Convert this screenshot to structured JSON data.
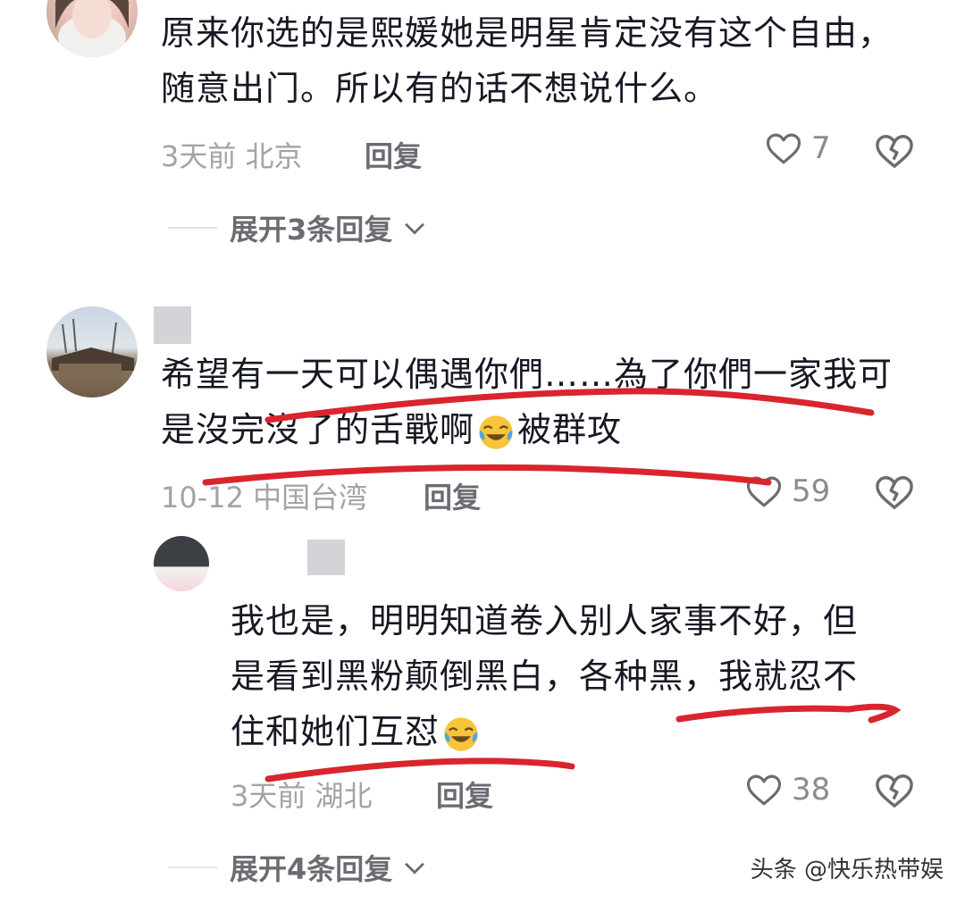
{
  "comments": [
    {
      "text": "原来你选的是熙媛她是明星肯定没有这个自由，随意出门。所以有的话不想说什么。",
      "time_location": "3天前 北京",
      "reply_label": "回复",
      "likes": "7",
      "expand_label": "展开3条回复"
    },
    {
      "text_a": "希望有一天可以偶遇你們……為了你們一家我可是沒完沒了的舌戰啊",
      "text_b": "被群攻",
      "time_location": "10-12 中国台湾",
      "reply_label": "回复",
      "likes": "59"
    }
  ],
  "sub_reply": {
    "text": "我也是，明明知道卷入别人家事不好，但是看到黑粉颠倒黑白，各种黑，我就忍不住和她们互怼",
    "time_location": "3天前 湖北",
    "reply_label": "回复",
    "likes": "38",
    "expand_label": "展开4条回复"
  },
  "watermark": "头条 @快乐热带娱",
  "colors": {
    "scribble": "#d9252e",
    "text": "#161823",
    "meta": "#a3a3a8"
  }
}
